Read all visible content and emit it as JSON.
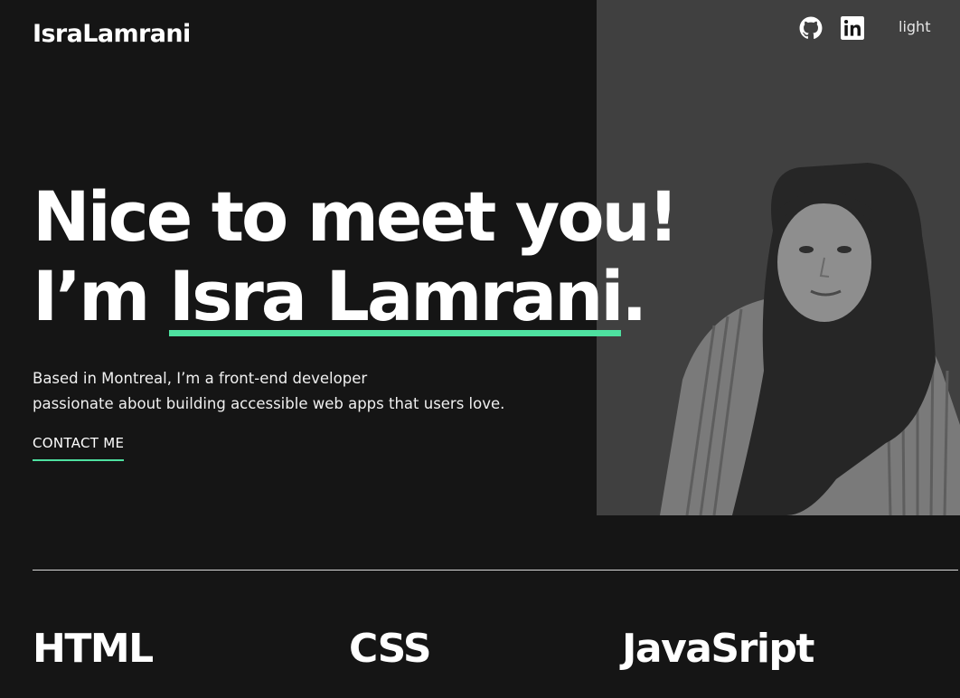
{
  "header": {
    "logo": "IsraLamrani",
    "social": [
      {
        "icon": "github-icon"
      },
      {
        "icon": "linkedin-icon"
      }
    ],
    "theme_toggle": "light"
  },
  "hero": {
    "title_line1": "Nice to meet you!",
    "title_prefix": "I’m ",
    "title_name": "Isra Lamrani",
    "title_suffix": ".",
    "intro_line1": "Based in Montreal, I’m a front-end developer",
    "intro_line2": "passionate about building accessible web apps that users love.",
    "contact_label": "CONTACT ME"
  },
  "skills": [
    {
      "title": "HTML"
    },
    {
      "title": "CSS"
    },
    {
      "title": "JavaSript"
    }
  ],
  "colors": {
    "background": "#151515",
    "accent": "#4ee1a0",
    "photo_panel": "#3f3f3f",
    "text": "#ffffff"
  }
}
